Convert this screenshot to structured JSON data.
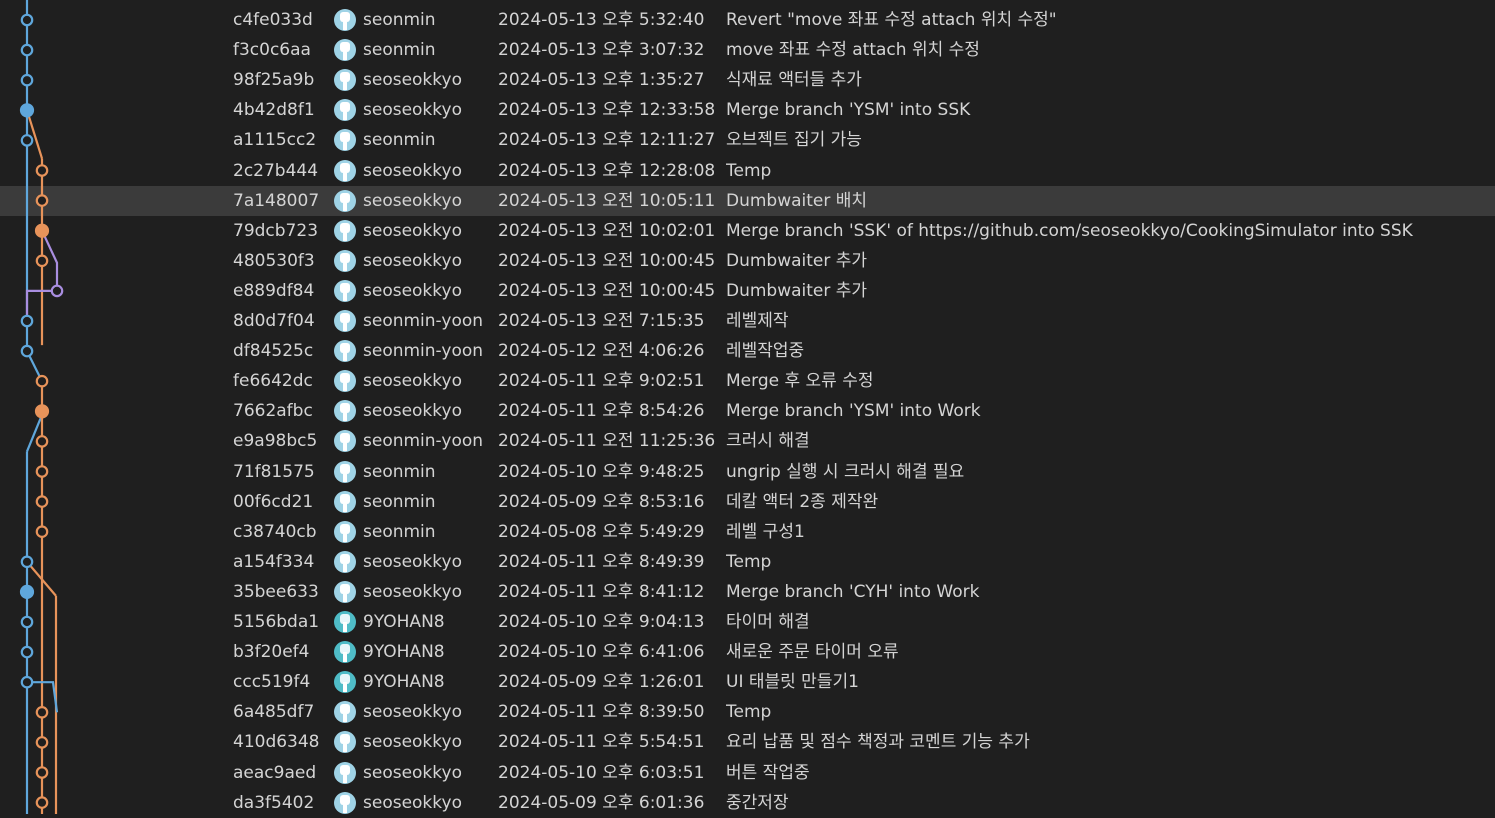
{
  "colors": {
    "background": "#1f1f1f",
    "selected_row": "#3b3b3b",
    "text": "#d4d4d4",
    "graph_blue": "#5fa7dc",
    "graph_orange": "#e7935a",
    "graph_purple": "#a98ee0"
  },
  "icons": {
    "avatar": "user-avatar-icon",
    "commit_node": "commit-dot-icon"
  },
  "selected_index": 6,
  "commits": [
    {
      "hash": "c4fe033d",
      "author": "seonmin",
      "date": "2024-05-13 오후 5:32:40",
      "message": "Revert \"move 좌표 수정 attach 위치 수정\""
    },
    {
      "hash": "f3c0c6aa",
      "author": "seonmin",
      "date": "2024-05-13 오후 3:07:32",
      "message": "move 좌표 수정 attach 위치 수정"
    },
    {
      "hash": "98f25a9b",
      "author": "seoseokkyo",
      "date": "2024-05-13 오후 1:35:27",
      "message": "식재료 액터들 추가"
    },
    {
      "hash": "4b42d8f1",
      "author": "seoseokkyo",
      "date": "2024-05-13 오후 12:33:58",
      "message": "Merge branch 'YSM' into SSK"
    },
    {
      "hash": "a1115cc2",
      "author": "seonmin",
      "date": "2024-05-13 오후 12:11:27",
      "message": "오브젝트 집기 가능"
    },
    {
      "hash": "2c27b444",
      "author": "seoseokkyo",
      "date": "2024-05-13 오후 12:28:08",
      "message": "Temp"
    },
    {
      "hash": "7a148007",
      "author": "seoseokkyo",
      "date": "2024-05-13 오전 10:05:11",
      "message": "Dumbwaiter 배치"
    },
    {
      "hash": "79dcb723",
      "author": "seoseokkyo",
      "date": "2024-05-13 오전 10:02:01",
      "message": "Merge branch 'SSK' of https://github.com/seoseokkyo/CookingSimulator into SSK"
    },
    {
      "hash": "480530f3",
      "author": "seoseokkyo",
      "date": "2024-05-13 오전 10:00:45",
      "message": "Dumbwaiter 추가"
    },
    {
      "hash": "e889df84",
      "author": "seoseokkyo",
      "date": "2024-05-13 오전 10:00:45",
      "message": "Dumbwaiter 추가"
    },
    {
      "hash": "8d0d7f04",
      "author": "seonmin-yoon",
      "date": "2024-05-13 오전 7:15:35",
      "message": "레벨제작"
    },
    {
      "hash": "df84525c",
      "author": "seonmin-yoon",
      "date": "2024-05-12 오전 4:06:26",
      "message": "레벨작업중"
    },
    {
      "hash": "fe6642dc",
      "author": "seoseokkyo",
      "date": "2024-05-11 오후 9:02:51",
      "message": "Merge 후 오류 수정"
    },
    {
      "hash": "7662afbc",
      "author": "seoseokkyo",
      "date": "2024-05-11 오후 8:54:26",
      "message": "Merge branch 'YSM' into Work"
    },
    {
      "hash": "e9a98bc5",
      "author": "seonmin-yoon",
      "date": "2024-05-11 오전 11:25:36",
      "message": "크러시 해결"
    },
    {
      "hash": "71f81575",
      "author": "seonmin",
      "date": "2024-05-10 오후 9:48:25",
      "message": "ungrip 실행 시 크러시 해결 필요"
    },
    {
      "hash": "00f6cd21",
      "author": "seonmin",
      "date": "2024-05-09 오후 8:53:16",
      "message": "데칼 액터 2종 제작완"
    },
    {
      "hash": "c38740cb",
      "author": "seonmin",
      "date": "2024-05-08 오후 5:49:29",
      "message": "레벨 구성1"
    },
    {
      "hash": "a154f334",
      "author": "seoseokkyo",
      "date": "2024-05-11 오후 8:49:39",
      "message": "Temp"
    },
    {
      "hash": "35bee633",
      "author": "seoseokkyo",
      "date": "2024-05-11 오후 8:41:12",
      "message": "Merge branch 'CYH' into Work"
    },
    {
      "hash": "5156bda1",
      "author": "9YOHAN8",
      "date": "2024-05-10 오후 9:04:13",
      "message": "타이머 해결"
    },
    {
      "hash": "b3f20ef4",
      "author": "9YOHAN8",
      "date": "2024-05-10 오후 6:41:06",
      "message": "새로운 주문 타이머 오류"
    },
    {
      "hash": "ccc519f4",
      "author": "9YOHAN8",
      "date": "2024-05-09 오후 1:26:01",
      "message": "UI 태블릿 만들기1"
    },
    {
      "hash": "6a485df7",
      "author": "seoseokkyo",
      "date": "2024-05-11 오후 8:39:50",
      "message": "Temp"
    },
    {
      "hash": "410d6348",
      "author": "seoseokkyo",
      "date": "2024-05-11 오후 5:54:51",
      "message": "요리 납품 및 점수 책정과 코멘트 기능 추가"
    },
    {
      "hash": "aeac9aed",
      "author": "seoseokkyo",
      "date": "2024-05-10 오후 6:03:51",
      "message": "버튼 작업중"
    },
    {
      "hash": "da3f5402",
      "author": "seoseokkyo",
      "date": "2024-05-09 오후 6:01:36",
      "message": "중간저장"
    }
  ]
}
